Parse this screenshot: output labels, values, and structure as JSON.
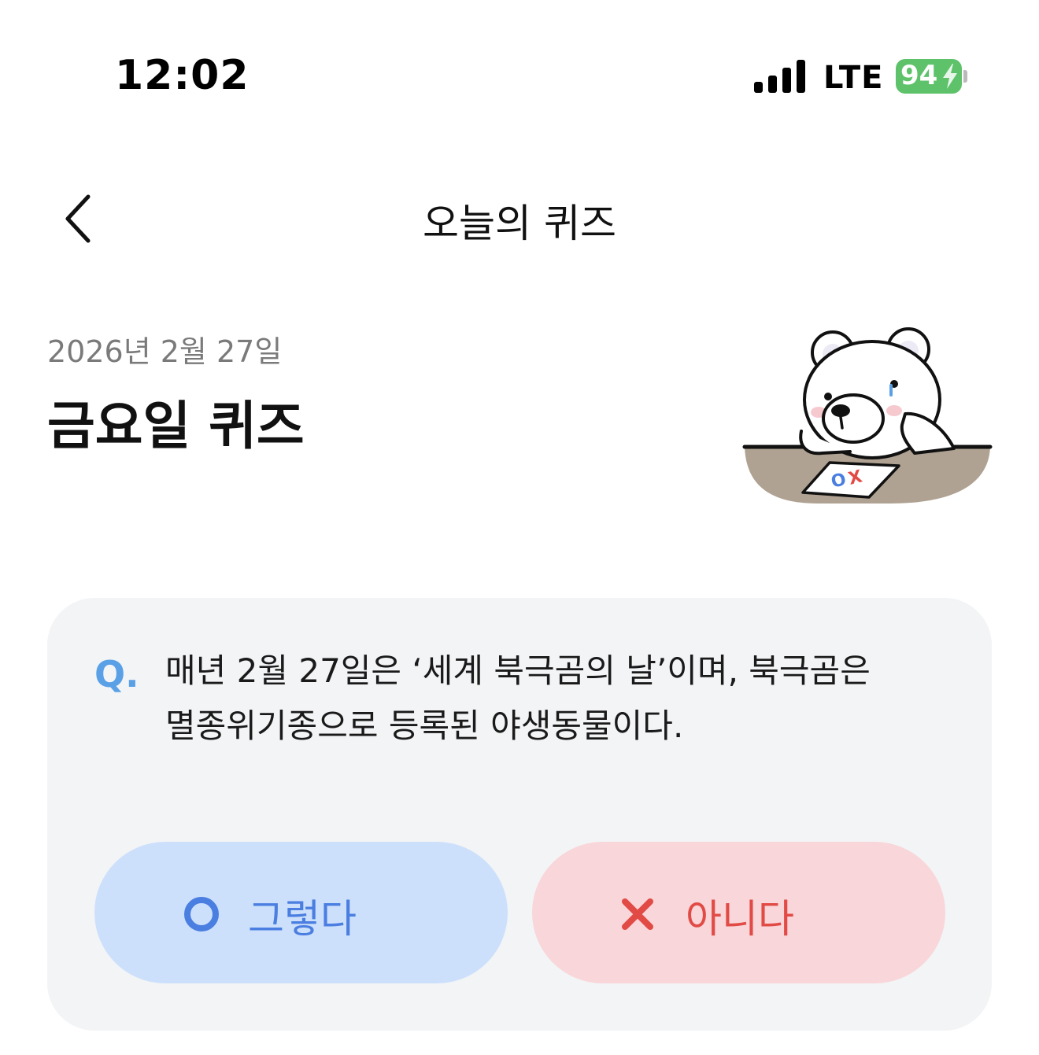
{
  "status_bar": {
    "time": "12:02",
    "network": "LTE",
    "battery": "94"
  },
  "nav": {
    "title": "오늘의 퀴즈"
  },
  "header": {
    "date": "2026년 2월 27일",
    "title": "금요일 퀴즈"
  },
  "quiz": {
    "q_mark": "Q.",
    "question_line1": "매년 2월 27일은 ‘세계 북극곰의 날’이며, 북극곰은",
    "question_line2": "멸종위기종으로 등록된 야생동물이다.",
    "answer_yes": "그렇다",
    "answer_no": "아니다"
  },
  "illustration": {
    "paper_o": "O",
    "paper_x": "X"
  },
  "colors": {
    "yes_bg": "#cde0fb",
    "yes_fg": "#4a7ee0",
    "no_bg": "#f8d6d9",
    "no_fg": "#e24a46",
    "q_mark": "#5aa0e6",
    "battery": "#5ec26a",
    "card_bg": "#f3f4f6"
  }
}
